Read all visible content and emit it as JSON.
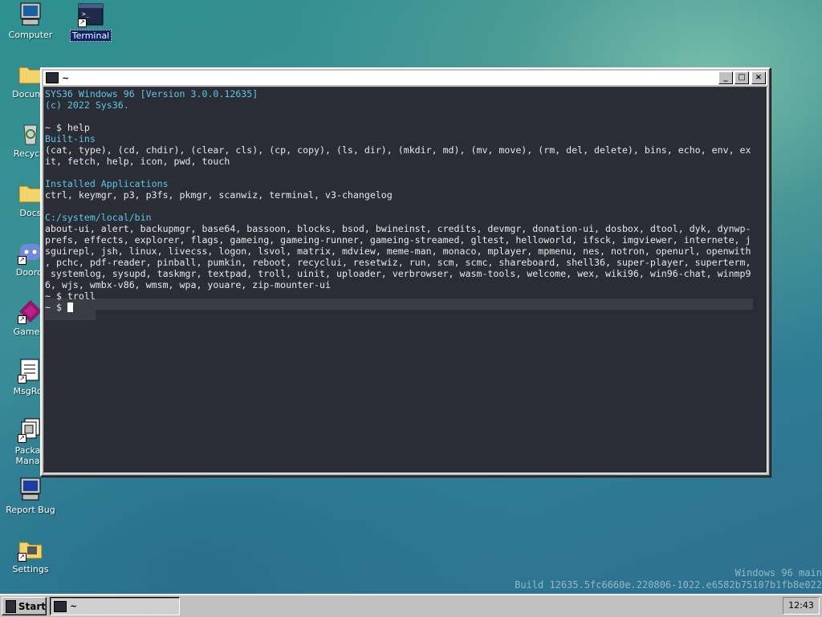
{
  "desktop": {
    "icons": [
      {
        "label": "Computer",
        "icon": "computer-icon"
      },
      {
        "label": "Terminal",
        "icon": "terminal-icon"
      },
      {
        "label": "Docume",
        "icon": "folder-icon"
      },
      {
        "label": "Recycle",
        "icon": "recycle-bin-icon"
      },
      {
        "label": "Docs",
        "icon": "folder-icon"
      },
      {
        "label": "Doordi",
        "icon": "discord-icon"
      },
      {
        "label": "Gamein",
        "icon": "gameing-icon"
      },
      {
        "label": "MsgRoo",
        "icon": "msgroom-icon"
      },
      {
        "label": "Packag",
        "label2": "Manag",
        "icon": "package-manager-icon"
      },
      {
        "label": "Report Bug",
        "icon": "report-bug-icon"
      },
      {
        "label": "Settings",
        "icon": "settings-icon"
      }
    ]
  },
  "window": {
    "title": "~",
    "buttons": {
      "minimize": "_",
      "maximize": "□",
      "close": "×"
    }
  },
  "terminal": {
    "lines": [
      "SYS36 Windows 96 [Version 3.0.0.12635]",
      "(c) 2022 Sys36.",
      "",
      "~ $ help",
      "Built-ins",
      "(cat, type), (cd, chdir), (clear, cls), (cp, copy), (ls, dir), (mkdir, md), (mv, move), (rm, del, delete), bins, echo, env, ex",
      "it, fetch, help, icon, pwd, touch",
      "",
      "Installed Applications",
      "ctrl, keymgr, p3, p3fs, pkmgr, scanwiz, terminal, v3-changelog",
      "",
      "C:/system/local/bin",
      "about-ui, alert, backupmgr, base64, bassoon, blocks, bsod, bwineinst, credits, devmgr, donation-ui, dosbox, dtool, dyk, dynwp-",
      "prefs, effects, explorer, flags, gameing, gameing-runner, gameing-streamed, gltest, helloworld, ifsck, imgviewer, internete, j",
      "sguirepl, jsh, linux, livecss, logon, lsvol, matrix, mdview, meme-man, monaco, mplayer, mpmenu, nes, notron, openurl, openwith",
      ", pchc, pdf-reader, pinball, pumkin, reboot, recyclui, resetwiz, run, scm, scmc, shareboard, shell36, super-player, superterm,",
      " systemlog, sysupd, taskmgr, textpad, troll, uinit, uploader, verbrowser, wasm-tools, welcome, wex, wiki96, win96-chat, winmp9",
      "6, wjs, wmbx-v86, wmsm, wpa, youare, zip-mounter-ui",
      "~ $ troll"
    ],
    "prompt": "~ $ ",
    "cyan_lines": [
      0,
      1,
      4,
      8,
      11
    ]
  },
  "watermark": {
    "line1": "Windows 96 main",
    "line2": "Build 12635.5fc6660e.220806-1022.e6582b75107b1fb8e022"
  },
  "taskbar": {
    "start_label": "Start",
    "task_label": "~",
    "clock": "12:43"
  },
  "colors": {
    "terminal_bg": "#2a2d36",
    "terminal_accent": "#5cc8e6",
    "titlebar_bg": "#ffffff",
    "chrome": "#c0c0c0"
  }
}
